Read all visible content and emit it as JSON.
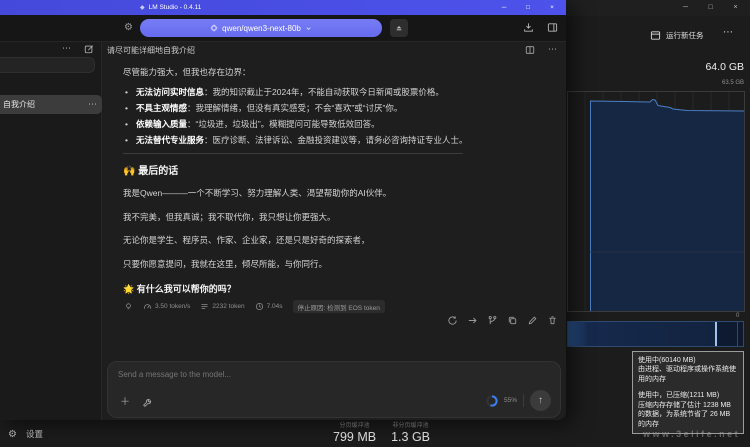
{
  "lm": {
    "title": "LM Studio - 0.4.11",
    "window_controls": {
      "minimize": "─",
      "maximize": "□",
      "close": "×"
    },
    "toolbar": {
      "model_label": "qwen/qwen3-next-80b"
    },
    "sidebar": {
      "chat_item_title": "自我介绍"
    },
    "chat": {
      "header_title": "请尽可能详细地自我介绍",
      "intro": "尽管能力强大，但我也存在边界：",
      "bullets": [
        {
          "lead": "无法访问实时信息",
          "body": "：我的知识截止于2024年，不能自动获取今日新闻或股票价格。"
        },
        {
          "lead": "不具主观情感",
          "body": "：我理解情绪，但没有真实感受；不会“喜欢”或“讨厌”你。"
        },
        {
          "lead": "依赖输入质量",
          "body": "：“垃圾进，垃圾出”。模糊提问可能导致低效回答。"
        },
        {
          "lead": "无法替代专业服务",
          "body": "：医疗诊断、法律诉讼、金融投资建议等，请务必咨询持证专业人士。"
        }
      ],
      "final_heading": "🙌 最后的话",
      "paragraphs": [
        "我是Qwen———一个不断学习、努力理解人类、渴望帮助你的AI伙伴。",
        "我不完美，但我真诚；我不取代你，我只想让你更强大。",
        "无论你是学生、程序员、作家、企业家，还是只是好奇的探索者，",
        "只要你愿意提问，我就在这里，倾尽所能，与你同行。"
      ],
      "closing": "🌟 有什么我可以帮你的吗？",
      "stats": {
        "speed": "3.50 token/s",
        "tokens": "2232 token",
        "duration": "7.04s",
        "stop_reason": "停止原因: 检测到 EOS token"
      },
      "input": {
        "placeholder": "Send a message to the model...",
        "context_usage": "55%"
      }
    }
  },
  "tm": {
    "window_controls": {
      "minimize": "─",
      "maximize": "□",
      "close": "×"
    },
    "run_new_task": "运行新任务",
    "more": "⋯",
    "memory_total": "64.0 GB",
    "memory_scale_top": "63.5 GB",
    "graph_axis_zero": "0",
    "pools": [
      {
        "label": "分页缓冲池",
        "value": "799 MB"
      },
      {
        "label": "非分页缓冲池",
        "value": "1.3 GB"
      }
    ],
    "settings_label": "设置",
    "tooltip": {
      "used_title": "使用中(60140 MB)",
      "used_desc": "由进程、驱动程序或操作系统使用的内存",
      "compressed_title": "使用中，已压缩(1211 MB)",
      "compressed_desc": "压缩内存存储了估计 1238 MB 的数据，为系统节省了 26 MB 的内存"
    }
  },
  "watermark": "www.3elife.net",
  "icons": {
    "ellipsis": "⋯",
    "gear": "⚙",
    "bullet": "•",
    "plus": "＋",
    "send_arrow": "↑",
    "gem": "◆"
  },
  "colors": {
    "titlebar_purple": "#4b50e2",
    "model_pill": "#6b70f0",
    "graph_fill": "#152743",
    "graph_line": "#4b7fc3",
    "progress_blue": "#3f7ef0"
  }
}
